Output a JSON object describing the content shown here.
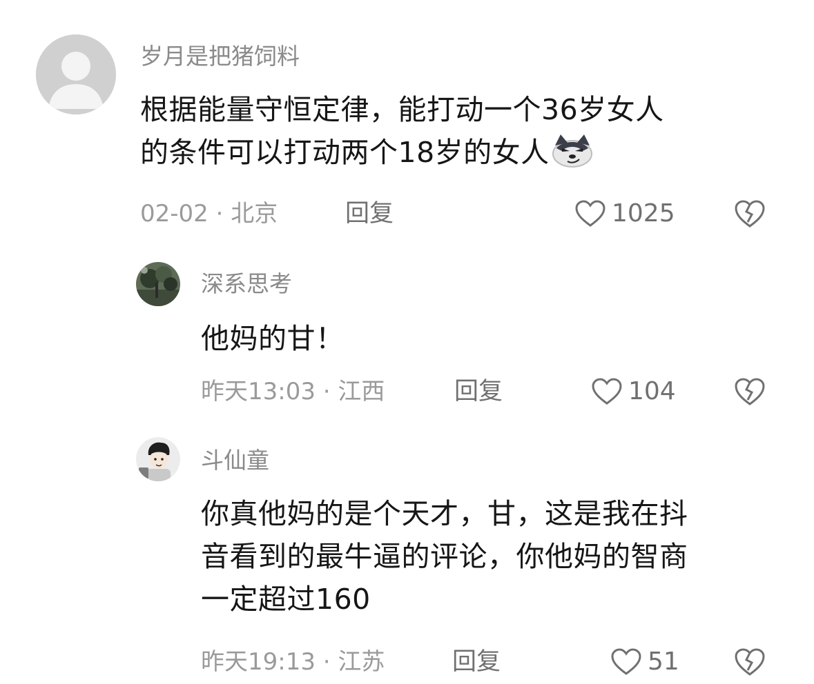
{
  "comments": [
    {
      "username": "岁月是把猪饲料",
      "text_lines": [
        "根据能量守恒定律，能打动一个36岁女人",
        "的条件可以打动两个18岁的女人"
      ],
      "emoji": "smirking-dog-emoji",
      "meta": "02-02 · 北京",
      "reply_label": "回复",
      "likes": "1025",
      "avatar": "default-avatar"
    },
    {
      "username": "深系思考",
      "text_lines": [
        "他妈的甘！"
      ],
      "meta": "昨天13:03 · 江西",
      "reply_label": "回复",
      "likes": "104",
      "avatar": "tree-avatar"
    },
    {
      "username": "斗仙童",
      "text_lines": [
        "你真他妈的是个天才，甘，这是我在抖",
        "音看到的最牛逼的评论，你他妈的智商",
        "一定超过160"
      ],
      "meta": "昨天19:13 · 江苏",
      "reply_label": "回复",
      "likes": "51",
      "avatar": "cartoon-boy-avatar"
    }
  ],
  "icons": {
    "like": "heart-outline-icon",
    "dislike": "broken-heart-icon"
  },
  "colors": {
    "username": "#8a8a8a",
    "body": "#161616",
    "meta": "#9a9a9a",
    "icon": "#707070"
  }
}
